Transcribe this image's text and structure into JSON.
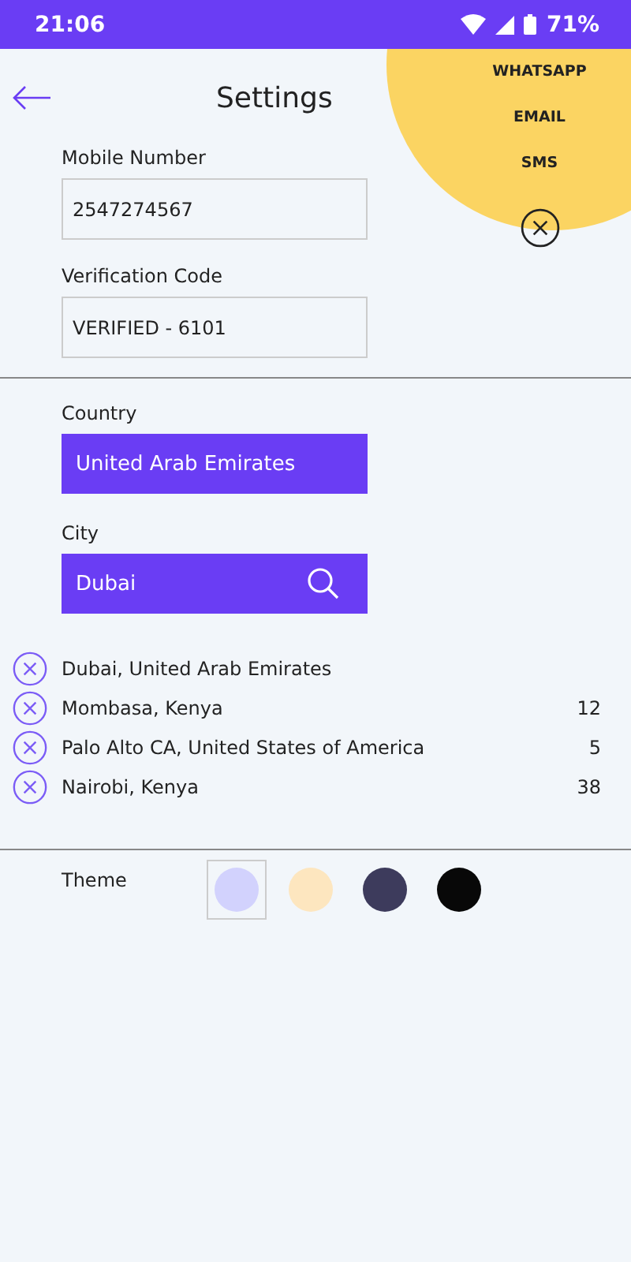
{
  "status_bar": {
    "time": "21:06",
    "battery": "71%"
  },
  "header": {
    "title": "Settings"
  },
  "share_menu": {
    "options": [
      "WHATSAPP",
      "EMAIL",
      "SMS"
    ]
  },
  "mobile_number": {
    "label": "Mobile Number",
    "value": "2547274567"
  },
  "verification_code": {
    "label": "Verification Code",
    "value": "VERIFIED - 6101"
  },
  "country": {
    "label": "Country",
    "value": "United Arab Emirates"
  },
  "city": {
    "label": "City",
    "value": "Dubai"
  },
  "locations": [
    {
      "name": "Dubai, United Arab Emirates"
    },
    {
      "name": "Mombasa, Kenya",
      "count": "12"
    },
    {
      "name": "Palo Alto CA, United States of America",
      "count": "5"
    },
    {
      "name": "Nairobi, Kenya",
      "count": "38"
    }
  ],
  "theme": {
    "label": "Theme",
    "swatches": [
      {
        "color": "#d2d2fd",
        "selected": true
      },
      {
        "color": "#fde6bf",
        "selected": false
      },
      {
        "color": "#3d3b5c",
        "selected": false
      },
      {
        "color": "#080808",
        "selected": false
      }
    ]
  }
}
